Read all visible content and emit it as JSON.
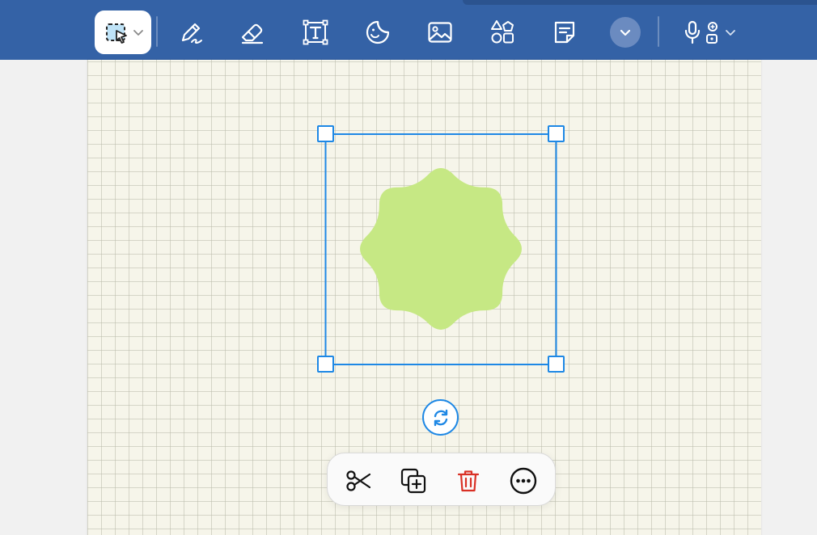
{
  "toolbar": {
    "tools": [
      {
        "name": "select-tool",
        "icon": "lasso-select-icon",
        "selected": true
      },
      {
        "name": "pen-tool",
        "icon": "pen-icon"
      },
      {
        "name": "eraser-tool",
        "icon": "eraser-icon"
      },
      {
        "name": "text-tool",
        "icon": "text-box-icon"
      },
      {
        "name": "sticker-tool",
        "icon": "sticker-icon"
      },
      {
        "name": "image-tool",
        "icon": "image-icon"
      },
      {
        "name": "shapes-tool",
        "icon": "shapes-icon"
      },
      {
        "name": "sticky-note-tool",
        "icon": "sticky-note-icon"
      },
      {
        "name": "more-tools",
        "icon": "chevron-down-icon"
      },
      {
        "name": "audio-tool",
        "icon": "microphone-icon"
      }
    ],
    "colors": {
      "background": "#3462a6",
      "icon": "#ffffff"
    }
  },
  "canvas": {
    "paper": "grid",
    "paper_color": "#f6f5ea"
  },
  "selection": {
    "shape": "eight-point-star",
    "fill_color": "#c6e884",
    "frame_color": "#1e88e5"
  },
  "context_menu": {
    "items": [
      {
        "name": "cut",
        "icon": "scissors-icon"
      },
      {
        "name": "duplicate",
        "icon": "duplicate-icon"
      },
      {
        "name": "delete",
        "icon": "trash-icon",
        "color": "#d93025"
      },
      {
        "name": "more",
        "icon": "more-horizontal-icon"
      }
    ]
  }
}
